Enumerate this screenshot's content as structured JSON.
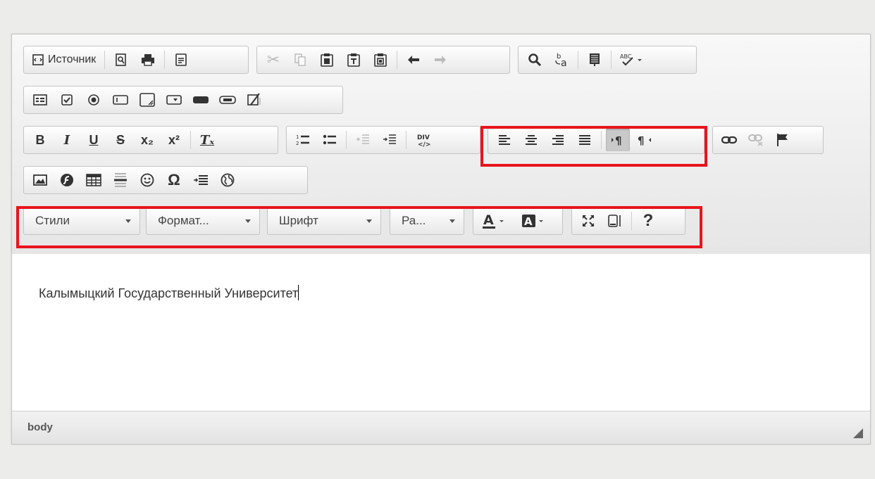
{
  "toolbar": {
    "row1": {
      "source_label": "Источник",
      "icons": {
        "source": "▣",
        "preview": "⌕",
        "print": "▤",
        "templates": "▭",
        "cut": "✂",
        "copy": "⧉",
        "paste": "▦",
        "paste_text": "▥",
        "paste_word": "▧",
        "undo": "↶",
        "redo": "↷",
        "find": "🔍",
        "replace": "ᵇa",
        "select_all": "▤",
        "spellcheck": "ᴬᴮᶜ✓▾"
      }
    },
    "row2": {
      "icons": {
        "form": "▤",
        "checkbox": "☑",
        "radio": "◉",
        "textfield": "▭",
        "textarea": "◫",
        "select": "▾",
        "button": "▬",
        "imagebutton": "▭",
        "hiddenfield": "⍁"
      }
    },
    "row3": {
      "icons": {
        "bold": "B",
        "italic": "I",
        "underline": "U",
        "strike": "S",
        "subscript": "x₂",
        "superscript": "x²",
        "remove_format": "Tₓ",
        "numbered_list": "⒈",
        "bulleted_list": "⁝≡",
        "outdent": "⇤",
        "indent": "⇥",
        "creatediv": "DIV",
        "align_left": "≡",
        "align_center": "≡",
        "align_right": "≡",
        "align_justify": "≣",
        "ltr": "▸¶",
        "rtl": "¶◂",
        "link": "∞",
        "unlink": "⌀",
        "anchor": "⚑"
      }
    },
    "row4": {
      "icons": {
        "image": "▨",
        "flash": "◕",
        "table": "▦",
        "hr": "≡",
        "smiley": "☺",
        "specialchar": "Ω",
        "pagebreak": "⇥≡",
        "iframe": "⊕"
      }
    },
    "row5": {
      "styles_label": "Стили",
      "format_label": "Формат...",
      "font_label": "Шрифт",
      "size_label": "Ра...",
      "text_color_icon": "A▾",
      "bg_color_icon": "▣▾",
      "maximize_icon": "⤢",
      "showblocks_icon": "▯",
      "about_icon": "?"
    }
  },
  "content": {
    "text": "Калымыцкий Государственный Университет"
  },
  "statusbar": {
    "path": "body"
  },
  "colors": {
    "highlight": "#e8141c"
  }
}
